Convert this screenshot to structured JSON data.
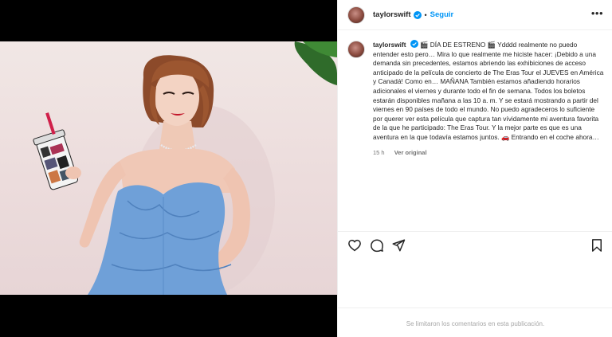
{
  "post": {
    "username": "taylorswift",
    "separator": "•",
    "follow_label": "Seguir",
    "more_label": "•••"
  },
  "caption": {
    "username": "taylorswift",
    "text": "🎬 DÍA DE ESTRENO 🎬 Ydddd realmente no puedo entender esto pero… Mira lo que realmente me hiciste hacer: ¡Debido a una demanda sin precedentes, estamos abriendo las exhibiciones de acceso anticipado de la película de concierto de The Eras Tour el JUEVES en América y Canadá! Como en… MAÑANA También estamos añadiendo horarios adicionales el viernes y durante todo el fin de semana. Todos los boletos estarán disponibles mañana a las 10 a. m. Y se estará mostrando a partir del viernes en 90 países de todo el mundo. No puedo agradeceros lo suficiente por querer ver esta película que captura tan vívidamente mi aventura favorita de la que he participado: The Eras Tour. Y la mejor parte es que es una aventura en la que todavía estamos juntos. 🚗 Entrando en el coche ahora…",
    "time": "15 h",
    "see_original": "Ver original"
  },
  "comments": {
    "disabled_notice": "Se limitaron los comentarios en esta publicación."
  },
  "colors": {
    "link_blue": "#0095f6",
    "verified_blue": "#0095f6",
    "text": "#262626",
    "muted": "#737373"
  },
  "icons": {
    "like": "heart-icon",
    "comment": "comment-icon",
    "share": "paper-plane-icon",
    "save": "bookmark-icon",
    "verified": "verified-badge-icon",
    "more": "more-options-icon"
  }
}
